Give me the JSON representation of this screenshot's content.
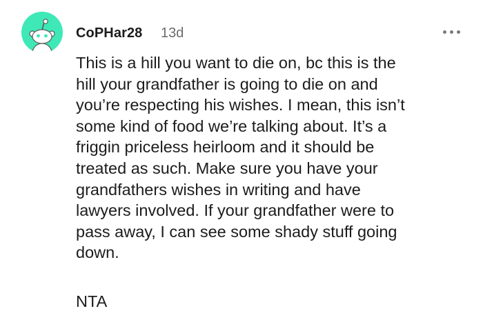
{
  "comment": {
    "author": "CoPHar28",
    "age": "13d",
    "avatar_icon": "reddit-snoo-icon",
    "avatar_color": "#3ee8b7",
    "more_icon": "more-options-icon",
    "body_lines": [
      "This is a hill you want to die on, bc this is the",
      "hill your grandfather is going to die on and",
      "you’re respecting his wishes. I mean, this isn’t",
      "some kind of food we’re talking about. It’s a",
      "friggin priceless heirloom and it should be",
      "treated as such. Make sure you have your",
      "grandfathers wishes in writing and have",
      "lawyers involved. If your grandfather were to",
      "pass away, I can see some shady stuff going",
      "down."
    ],
    "verdict": "NTA"
  }
}
